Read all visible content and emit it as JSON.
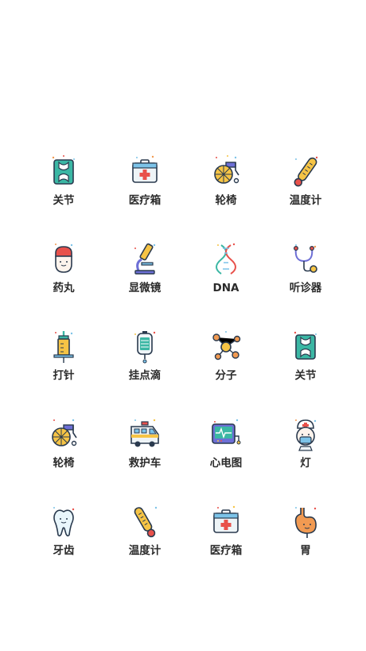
{
  "icons": [
    {
      "label": "关节",
      "icon": "joint-icon"
    },
    {
      "label": "医疗箱",
      "icon": "medical-kit-icon"
    },
    {
      "label": "轮椅",
      "icon": "wheelchair-icon"
    },
    {
      "label": "温度计",
      "icon": "thermometer-icon"
    },
    {
      "label": "药丸",
      "icon": "pill-icon"
    },
    {
      "label": "显微镜",
      "icon": "microscope-icon"
    },
    {
      "label": "DNA",
      "icon": "dna-icon"
    },
    {
      "label": "听诊器",
      "icon": "stethoscope-icon"
    },
    {
      "label": "打针",
      "icon": "syringe-icon"
    },
    {
      "label": "挂点滴",
      "icon": "iv-drip-icon"
    },
    {
      "label": "分子",
      "icon": "molecule-icon"
    },
    {
      "label": "关节",
      "icon": "joint-icon"
    },
    {
      "label": "轮椅",
      "icon": "wheelchair-icon"
    },
    {
      "label": "救护车",
      "icon": "ambulance-icon"
    },
    {
      "label": "心电图",
      "icon": "ecg-monitor-icon"
    },
    {
      "label": "灯",
      "icon": "nurse-icon"
    },
    {
      "label": "牙齿",
      "icon": "tooth-icon"
    },
    {
      "label": "温度计",
      "icon": "thermometer-icon"
    },
    {
      "label": "医疗箱",
      "icon": "medical-kit-icon"
    },
    {
      "label": "胃",
      "icon": "stomach-icon"
    }
  ],
  "colors": {
    "outline": "#2a3a4e",
    "teal": "#3bb7a4",
    "red": "#e8514b",
    "yellow": "#f6c445",
    "blue": "#7cc3e8",
    "purple": "#6d6fd6",
    "orange": "#f19a52",
    "label": "#2b2b2b"
  }
}
